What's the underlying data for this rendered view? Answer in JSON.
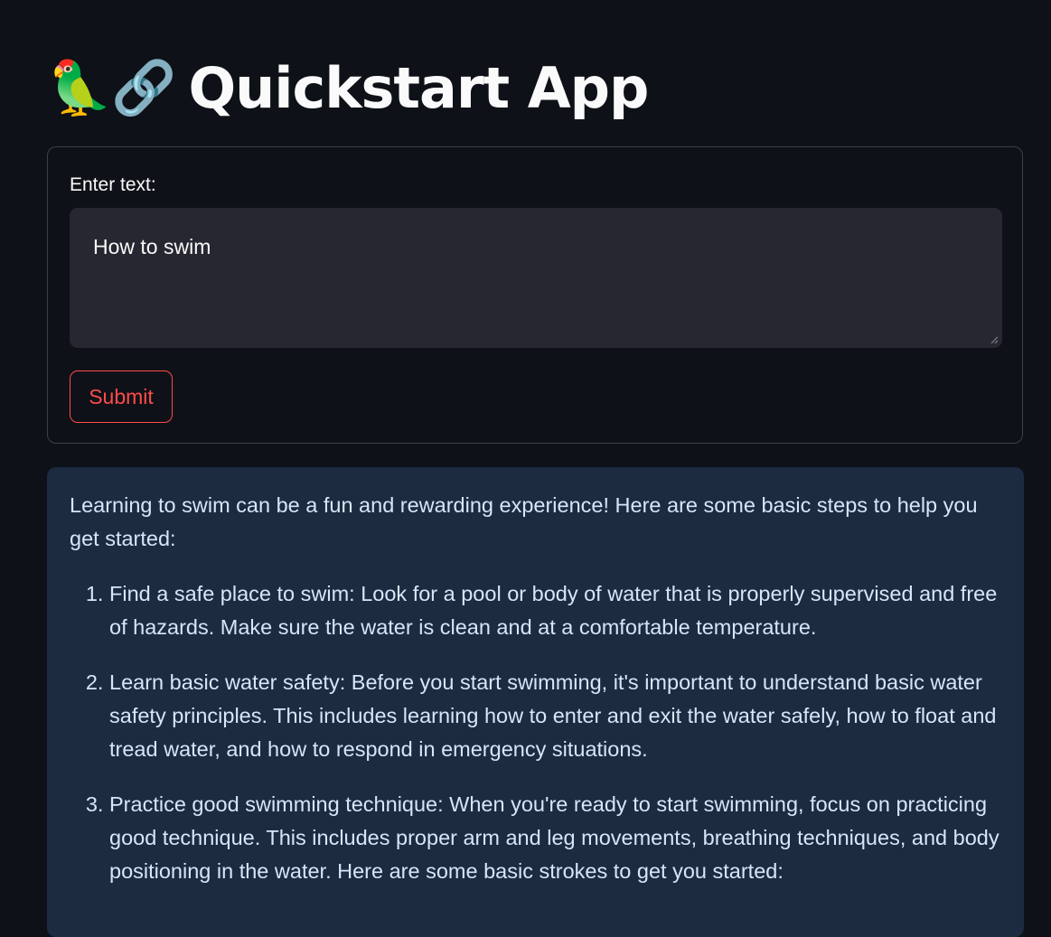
{
  "header": {
    "emoji_parrot": "🦜",
    "emoji_link": "🔗",
    "title": "Quickstart App"
  },
  "form": {
    "label": "Enter text:",
    "input_value": "How to swim",
    "submit_label": "Submit"
  },
  "response": {
    "intro": "Learning to swim can be a fun and rewarding experience! Here are some basic steps to help you get started:",
    "steps": [
      "Find a safe place to swim: Look for a pool or body of water that is properly supervised and free of hazards. Make sure the water is clean and at a comfortable temperature.",
      "Learn basic water safety: Before you start swimming, it's important to understand basic water safety principles. This includes learning how to enter and exit the water safely, how to float and tread water, and how to respond in emergency situations.",
      "Practice good swimming technique: When you're ready to start swimming, focus on practicing good technique. This includes proper arm and leg movements, breathing techniques, and body positioning in the water. Here are some basic strokes to get you started:"
    ]
  },
  "colors": {
    "background": "#0e1117",
    "accent": "#ff4b4b",
    "response_background": "#1c2b40",
    "input_background": "#262730"
  }
}
